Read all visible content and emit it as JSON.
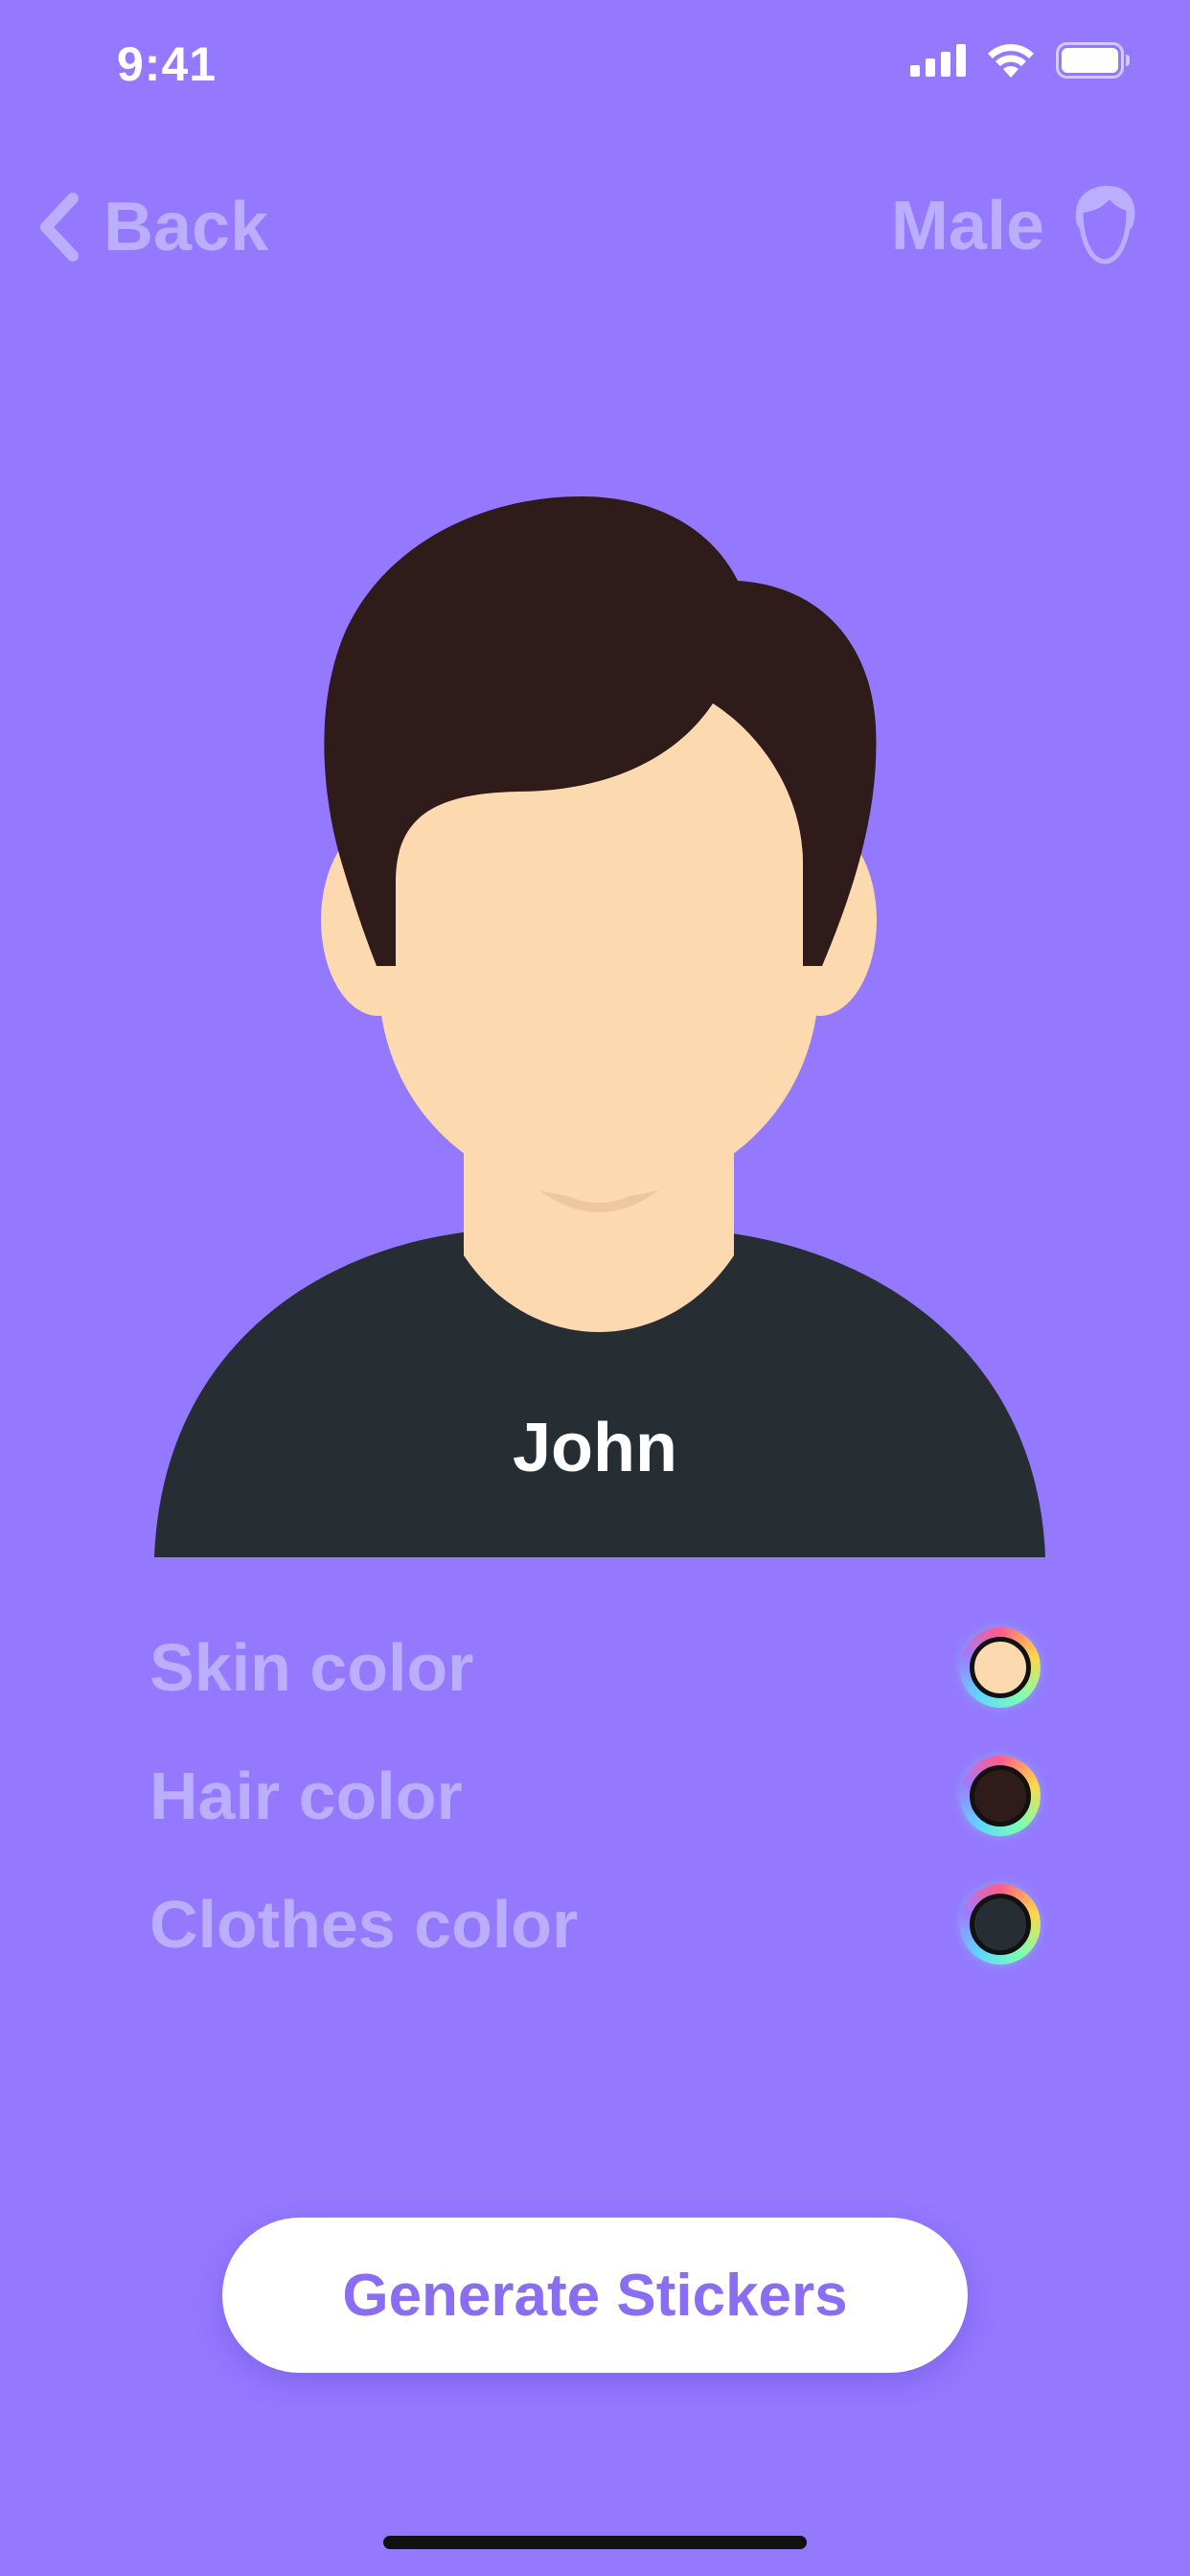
{
  "status_bar": {
    "time": "9:41"
  },
  "nav": {
    "back_label": "Back",
    "gender_label": "Male"
  },
  "avatar": {
    "name": "John"
  },
  "color_options": [
    {
      "label": "Skin color",
      "color": "#FDD9B0"
    },
    {
      "label": "Hair color",
      "color": "#2F1B19"
    },
    {
      "label": "Clothes color",
      "color": "#262D33"
    }
  ],
  "generate_button": {
    "label": "Generate Stickers"
  },
  "colors": {
    "background": "#9479FF",
    "muted_text": "#BCAEFF",
    "button_text": "#8A6DF2",
    "skin": "#FDD9B0",
    "hair": "#2F1B19",
    "clothes": "#262D33"
  }
}
